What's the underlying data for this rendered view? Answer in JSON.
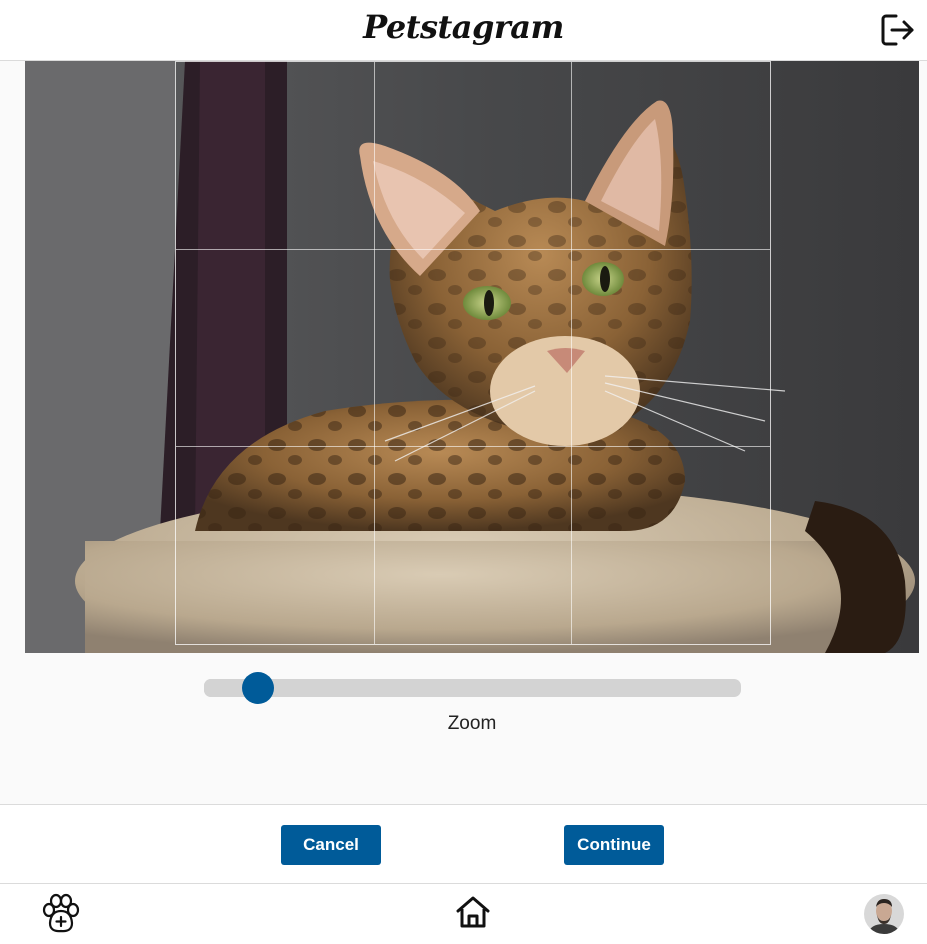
{
  "header": {
    "logo_text": "Petstagram",
    "logout_icon": "logout-icon"
  },
  "cropper": {
    "image_subject": "bengal-cat-photo",
    "grid": "rule-of-thirds"
  },
  "zoom": {
    "label": "Zoom",
    "value_fraction": 0.1
  },
  "actions": {
    "cancel_label": "Cancel",
    "continue_label": "Continue"
  },
  "bottom_nav": {
    "add_pet_icon": "paw-plus-icon",
    "home_icon": "home-icon",
    "profile_icon": "avatar"
  },
  "colors": {
    "accent": "#005b99",
    "slider_track": "#d3d3d3",
    "page_bg": "#fafafa",
    "border": "#dbdbdb"
  }
}
